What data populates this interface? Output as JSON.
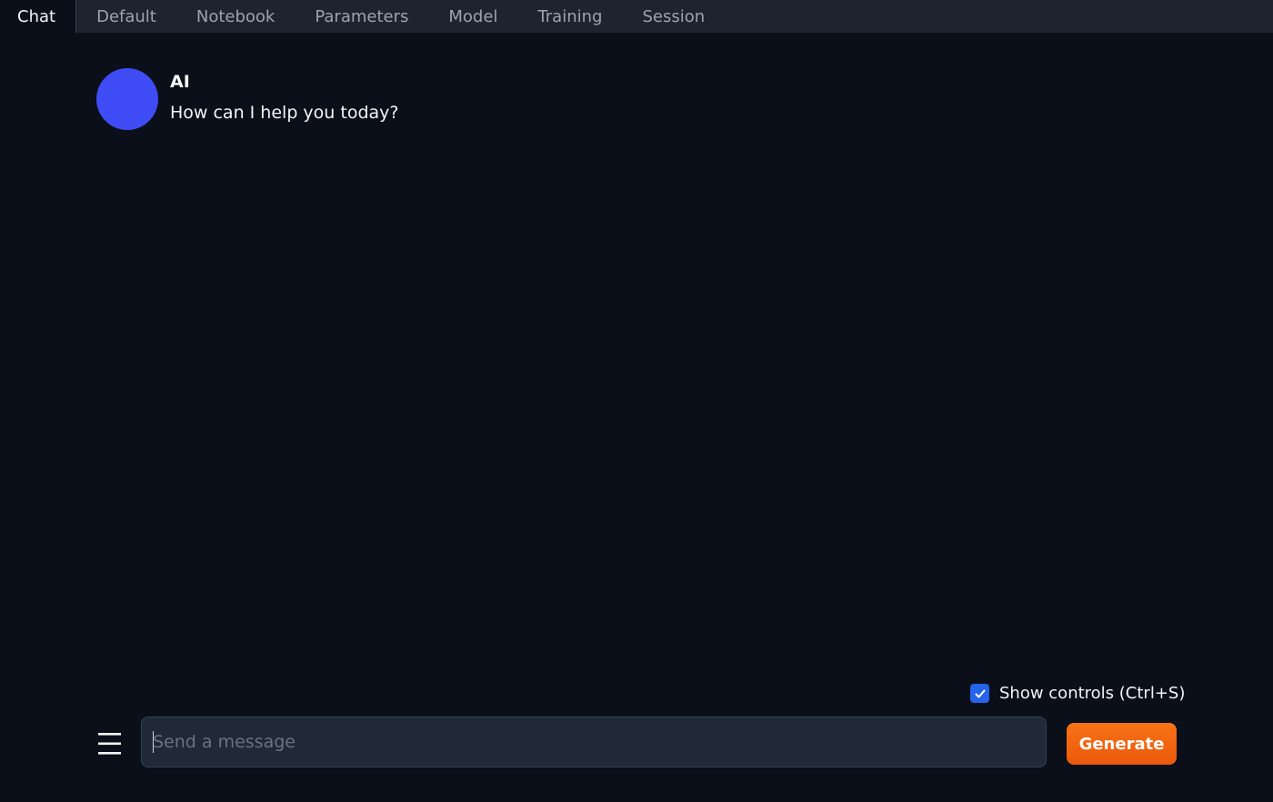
{
  "tabs": [
    {
      "label": "Chat",
      "active": true
    },
    {
      "label": "Default",
      "active": false
    },
    {
      "label": "Notebook",
      "active": false
    },
    {
      "label": "Parameters",
      "active": false
    },
    {
      "label": "Model",
      "active": false
    },
    {
      "label": "Training",
      "active": false
    },
    {
      "label": "Session",
      "active": false
    }
  ],
  "chat": {
    "messages": [
      {
        "author": "AI",
        "text": "How can I help you today?",
        "avatar_color": "#3f4cf5"
      }
    ]
  },
  "controls": {
    "show_controls_label": "Show controls (Ctrl+S)",
    "show_controls_checked": true
  },
  "input": {
    "placeholder": "Send a message",
    "value": ""
  },
  "actions": {
    "menu_icon": "hamburger-menu-icon",
    "generate_label": "Generate",
    "generate_color": "#f97316"
  }
}
